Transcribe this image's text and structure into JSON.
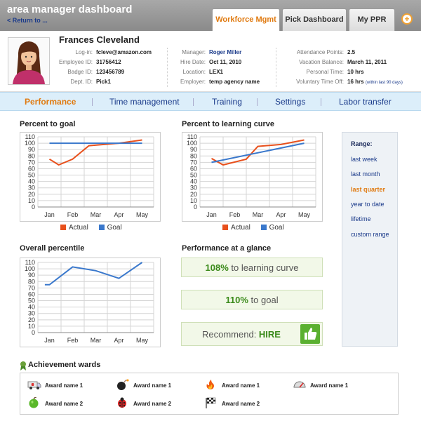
{
  "header": {
    "title": "area manager dashboard",
    "return_link": "< Return to ...",
    "tabs": [
      {
        "label": "Workforce Mgmt",
        "active": true
      },
      {
        "label": "Pick Dashboard",
        "active": false
      },
      {
        "label": "My PPR",
        "active": false
      }
    ],
    "add_label": "+"
  },
  "profile": {
    "name": "Frances Cleveland",
    "col1": [
      {
        "label": "Log-in:",
        "value": "fcleve@amazon.com"
      },
      {
        "label": "Employee ID:",
        "value": "31756412"
      },
      {
        "label": "Badge ID:",
        "value": "123456789"
      },
      {
        "label": "Dept. ID:",
        "value": "Pick1"
      }
    ],
    "col2": [
      {
        "label": "Manager:",
        "value": "Roger Miller"
      },
      {
        "label": "Hire Date:",
        "value": "Oct 11, 2010"
      },
      {
        "label": "Location:",
        "value": "LEX1"
      },
      {
        "label": "Employer:",
        "value": "temp agency name"
      }
    ],
    "col3": [
      {
        "label": "Attendance Points:",
        "value": "2.5"
      },
      {
        "label": "Vacation Balance:",
        "value": "March 11, 2011"
      },
      {
        "label": "Personal Time:",
        "value": "10 hrs"
      },
      {
        "label": "Voluntary Time Off:",
        "value": "16 hrs",
        "note": "(within last 90 days)"
      }
    ]
  },
  "nav": {
    "items": [
      "Performance",
      "Time management",
      "Training",
      "Settings",
      "Labor transfer"
    ],
    "active": "Performance"
  },
  "colors": {
    "actual": "#e8501c",
    "goal": "#3a78cc",
    "accent": "#e07a10",
    "link": "#1a3a8a",
    "positive": "#3a8a1a"
  },
  "chart_data": [
    {
      "type": "line",
      "title": "Percent to goal",
      "categories": [
        "Jan",
        "Feb",
        "Mar",
        "Apr",
        "May"
      ],
      "ylim": [
        0,
        110
      ],
      "yticks": [
        0,
        10,
        20,
        30,
        40,
        50,
        60,
        70,
        80,
        90,
        100,
        110
      ],
      "grid": true,
      "legend": "bottom",
      "series": [
        {
          "name": "Actual",
          "x": [
            0,
            0.4,
            1,
            1.7,
            3,
            4
          ],
          "values": [
            75,
            66,
            75,
            96,
            100,
            105
          ]
        },
        {
          "name": "Goal",
          "x": [
            0,
            4
          ],
          "values": [
            100,
            100
          ]
        }
      ]
    },
    {
      "type": "line",
      "title": "Percent to learning curve",
      "categories": [
        "Jan",
        "Feb",
        "Mar",
        "Apr",
        "May"
      ],
      "ylim": [
        0,
        110
      ],
      "yticks": [
        0,
        10,
        20,
        30,
        40,
        50,
        60,
        70,
        80,
        90,
        100,
        110
      ],
      "grid": true,
      "legend": "bottom",
      "series": [
        {
          "name": "Actual",
          "x": [
            0,
            0.5,
            1.5,
            2,
            3,
            4
          ],
          "values": [
            76,
            66,
            75,
            95,
            98,
            105
          ]
        },
        {
          "name": "Goal",
          "x": [
            0,
            4
          ],
          "values": [
            70,
            100
          ]
        }
      ]
    },
    {
      "type": "line",
      "title": "Overall percentile",
      "categories": [
        "Jan",
        "Feb",
        "Mar",
        "Apr",
        "May"
      ],
      "ylim": [
        0,
        110
      ],
      "yticks": [
        0,
        10,
        20,
        30,
        40,
        50,
        60,
        70,
        80,
        90,
        100,
        110
      ],
      "grid": true,
      "series": [
        {
          "name": "",
          "x": [
            -0.2,
            0,
            1,
            2,
            3,
            4
          ],
          "values": [
            75,
            75,
            103,
            97,
            85,
            110
          ]
        }
      ]
    }
  ],
  "glance": {
    "title": "Performance at a glance",
    "learning_value": "108%",
    "learning_text": " to learning curve",
    "goal_value": "110%",
    "goal_text": " to goal",
    "recommend_text": "Recommend: ",
    "recommend_value": "HIRE"
  },
  "range": {
    "title": "Range:",
    "items": [
      "last week",
      "last month",
      "last quarter",
      "year to date",
      "lifetime",
      "custom range"
    ],
    "active": "last quarter"
  },
  "achievements": {
    "title": "Achievement wards",
    "awards": [
      {
        "icon": "ambulance-icon",
        "label": "Award name 1"
      },
      {
        "icon": "bomb-icon",
        "label": "Award name 1"
      },
      {
        "icon": "fire-icon",
        "label": "Award name 1"
      },
      {
        "icon": "gauge-icon",
        "label": "Award name 1"
      },
      {
        "icon": "apple-icon",
        "label": "Award name 2"
      },
      {
        "icon": "ladybug-icon",
        "label": "Award name 2"
      },
      {
        "icon": "checkered-flag-icon",
        "label": "Award name 2"
      }
    ]
  }
}
